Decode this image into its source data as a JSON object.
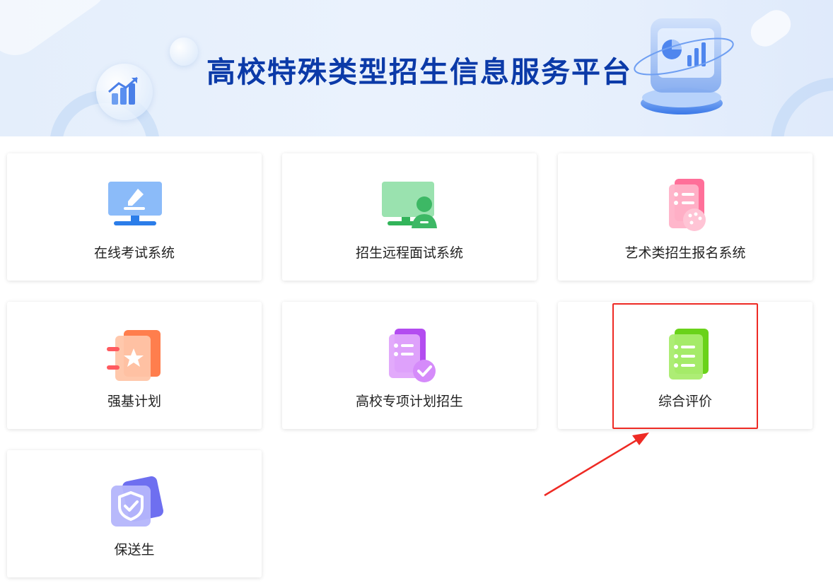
{
  "banner": {
    "title": "高校特殊类型招生信息服务平台"
  },
  "cards": [
    {
      "label": "在线考试系统",
      "icon": "online-exam-monitor-icon"
    },
    {
      "label": "招生远程面试系统",
      "icon": "remote-interview-screen-icon"
    },
    {
      "label": "艺术类招生报名系统",
      "icon": "art-palette-document-icon"
    },
    {
      "label": "强基计划",
      "icon": "star-notebook-icon"
    },
    {
      "label": "高校专项计划招生",
      "icon": "checklist-document-icon"
    },
    {
      "label": "综合评价",
      "icon": "list-document-icon"
    },
    {
      "label": "保送生",
      "icon": "shield-check-icon"
    }
  ],
  "annotation": {
    "highlight_color": "#ee2a24",
    "highlighted_card": "综合评价"
  }
}
